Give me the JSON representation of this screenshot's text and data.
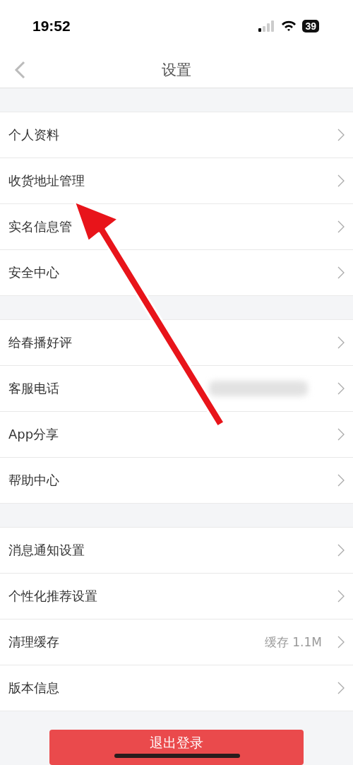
{
  "status_bar": {
    "time": "19:52",
    "battery": "39"
  },
  "nav": {
    "title": "设置"
  },
  "groups": [
    [
      {
        "label": "个人资料"
      },
      {
        "label": "收货地址管理"
      },
      {
        "label": "实名信息管"
      },
      {
        "label": "安全中心"
      }
    ],
    [
      {
        "label": "给春播好评"
      },
      {
        "label": "客服电话",
        "kind": "blurred"
      },
      {
        "label": "App分享"
      },
      {
        "label": "帮助中心"
      }
    ],
    [
      {
        "label": "消息通知设置"
      },
      {
        "label": "个性化推荐设置"
      },
      {
        "label": "清理缓存",
        "value": "缓存 1.1M"
      },
      {
        "label": "版本信息"
      }
    ]
  ],
  "logout_button": "退出登录"
}
